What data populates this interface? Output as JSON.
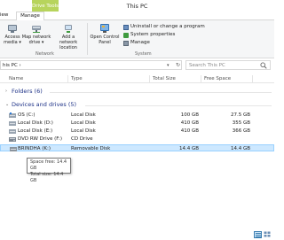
{
  "window": {
    "title": "This PC",
    "context_tab": "Drive Tools"
  },
  "tabs": {
    "view": "iew",
    "manage": "Manage"
  },
  "ribbon": {
    "access_media": {
      "line1": "Access",
      "line2": "media ▾"
    },
    "map_network_drive": {
      "line1": "Map network",
      "line2": "drive ▾"
    },
    "add_network_location": {
      "line1": "Add a network",
      "line2": "location"
    },
    "network_group": "Network",
    "open_control_panel": {
      "line1": "Open Control",
      "line2": "Panel"
    },
    "uninstall_program": "Uninstall or change a program",
    "system_properties": "System properties",
    "manage": "Manage",
    "system_group": "System"
  },
  "address": {
    "path": "his PC  ›",
    "search_placeholder": "Search This PC"
  },
  "columns": {
    "name": "Name",
    "type": "Type",
    "total_size": "Total Size",
    "free_space": "Free Space"
  },
  "groups": {
    "folders": "Folders (6)",
    "devices": "Devices and drives (5)"
  },
  "drives": [
    {
      "name": "OS (C:)",
      "type": "Local Disk",
      "total": "100 GB",
      "free": "27.5 GB",
      "icon": "windows-drive-icon"
    },
    {
      "name": "Local Disk (D:)",
      "type": "Local Disk",
      "total": "410 GB",
      "free": "355 GB",
      "icon": "hard-drive-icon"
    },
    {
      "name": "Local Disk (E:)",
      "type": "Local Disk",
      "total": "410 GB",
      "free": "366 GB",
      "icon": "hard-drive-icon"
    },
    {
      "name": "DVD RW Drive (F:)",
      "type": "CD Drive",
      "total": "",
      "free": "",
      "icon": "dvd-drive-icon"
    },
    {
      "name": "BRINDHA (K:)",
      "type": "Removable Disk",
      "total": "14.4 GB",
      "free": "14.4 GB",
      "icon": "usb-drive-icon"
    }
  ],
  "tooltip": {
    "line1": "Space free: 14.4 GB",
    "line2": "Total size: 14.4 GB"
  },
  "colors": {
    "context_tab": "#b7d45c",
    "group_header": "#1e3287",
    "selection": "#cde8ff"
  }
}
